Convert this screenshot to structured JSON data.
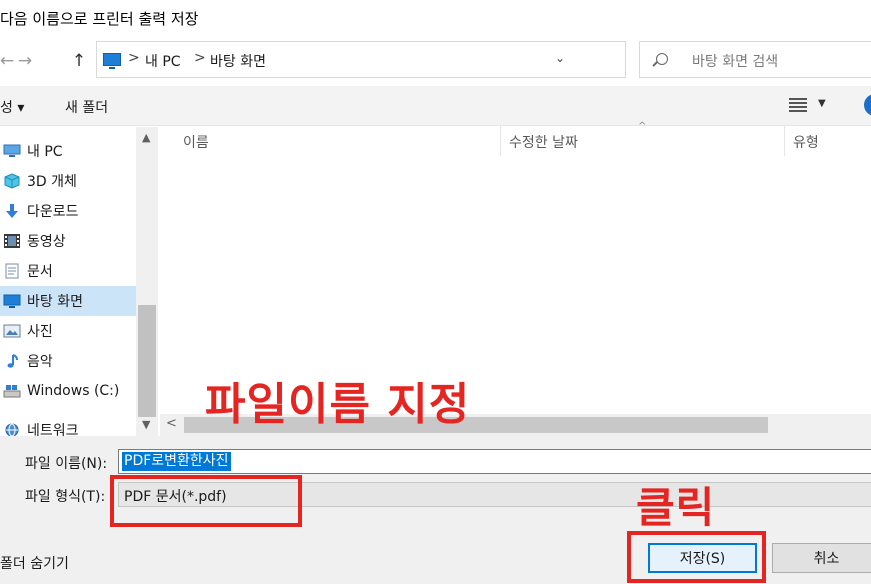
{
  "window": {
    "title": "다음 이름으로 프린터 출력 저장"
  },
  "address_bar": {
    "crumbs": [
      "내 PC",
      "바탕 화면"
    ],
    "separator": ">",
    "dropdown_glyph": "⌄",
    "refresh_glyph": "⟳"
  },
  "nav_glyphs": {
    "back": "←",
    "forward": "→",
    "up": "↑"
  },
  "search": {
    "placeholder": "바탕 화면 검색"
  },
  "toolbar": {
    "organize_label": "성 ▾",
    "new_folder_label": "새 폴더",
    "view_dropdown_glyph": "▼"
  },
  "navigation": {
    "items": [
      {
        "label": "내 PC",
        "icon": "pc-icon"
      },
      {
        "label": "3D 개체",
        "icon": "cube-icon"
      },
      {
        "label": "다운로드",
        "icon": "download-icon"
      },
      {
        "label": "동영상",
        "icon": "film-icon"
      },
      {
        "label": "문서",
        "icon": "document-icon"
      },
      {
        "label": "바탕 화면",
        "icon": "desktop-icon",
        "selected": true
      },
      {
        "label": "사진",
        "icon": "picture-icon"
      },
      {
        "label": "음악",
        "icon": "music-icon"
      },
      {
        "label": "Windows (C:)",
        "icon": "drive-icon"
      },
      {
        "label": "네트워크",
        "icon": "network-icon"
      }
    ],
    "scroll_up_glyph": "▲",
    "scroll_down_glyph": "▼"
  },
  "file_list": {
    "columns": [
      "이름",
      "수정한 날짜",
      "유형"
    ],
    "sort_glyph": "^",
    "scroll_left_glyph": "<"
  },
  "form": {
    "filename_label": "파일 이름(N):",
    "filename_value": "PDF로변환한사진",
    "filetype_label": "파일 형식(T):",
    "filetype_value": "PDF 문서(*.pdf)"
  },
  "footer": {
    "hide_folders_label": "폴더 숨기기",
    "save_label": "저장(S)",
    "cancel_label": "취소"
  },
  "annotations": {
    "filename_note": "파일이름 지정",
    "click_note": "클릭",
    "color": "#e52521"
  },
  "colors": {
    "accent": "#0078d7",
    "selection": "#cce4f7",
    "annotation": "#e52521"
  }
}
